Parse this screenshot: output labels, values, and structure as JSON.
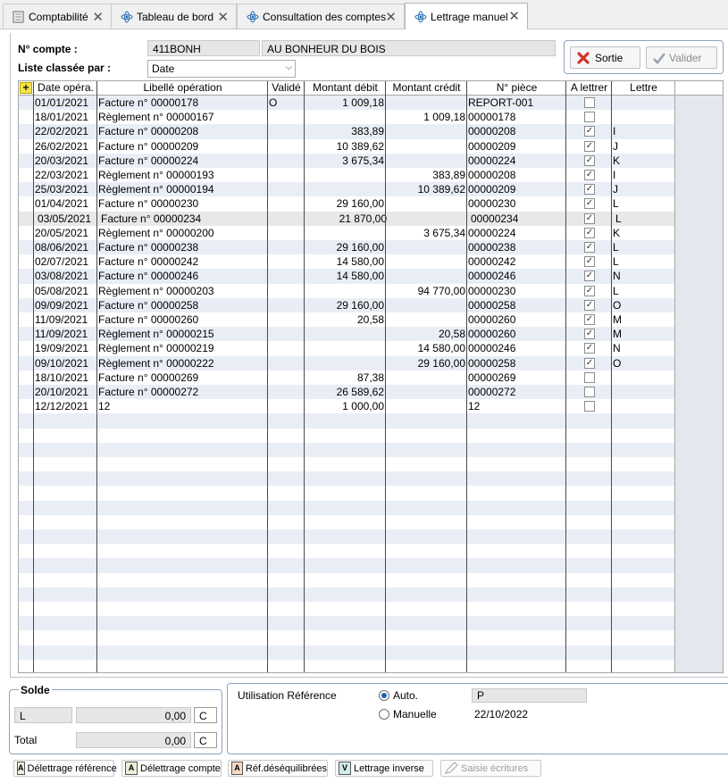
{
  "tabs": [
    {
      "label": "Comptabilité",
      "icon": "ledger-icon"
    },
    {
      "label": "Tableau de bord",
      "icon": "atom-icon"
    },
    {
      "label": "Consultation des comptes",
      "icon": "atom-icon"
    },
    {
      "label": "Lettrage manuel",
      "icon": "atom-icon",
      "active": true
    }
  ],
  "header": {
    "compte_label": "N° compte :",
    "compte_code": "411BONH",
    "compte_name": "AU BONHEUR DU BOIS",
    "tri_label": "Liste classée par :",
    "tri_value": "Date",
    "sortie_label": "Sortie",
    "valider_label": "Valider"
  },
  "grid": {
    "columns": [
      "Date opéra.",
      "Libellé opération",
      "Validé",
      "Montant débit",
      "Montant crédit",
      "N° pièce",
      "A lettrer",
      "Lettre"
    ],
    "rows": [
      {
        "date": "01/01/2021",
        "libelle": "Facture n° 00000178",
        "valide": "O",
        "debit": "1 009,18",
        "credit": "",
        "piece": "REPORT-001",
        "checked": false,
        "lettre": ""
      },
      {
        "date": "18/01/2021",
        "libelle": "Règlement n° 00000167",
        "valide": "",
        "debit": "",
        "credit": "1 009,18",
        "piece": "00000178",
        "checked": false,
        "lettre": ""
      },
      {
        "date": "22/02/2021",
        "libelle": "Facture n° 00000208",
        "valide": "",
        "debit": "383,89",
        "credit": "",
        "piece": "00000208",
        "checked": true,
        "lettre": "I"
      },
      {
        "date": "26/02/2021",
        "libelle": "Facture n° 00000209",
        "valide": "",
        "debit": "10 389,62",
        "credit": "",
        "piece": "00000209",
        "checked": true,
        "lettre": "J"
      },
      {
        "date": "20/03/2021",
        "libelle": "Facture n° 00000224",
        "valide": "",
        "debit": "3 675,34",
        "credit": "",
        "piece": "00000224",
        "checked": true,
        "lettre": "K"
      },
      {
        "date": "22/03/2021",
        "libelle": "Règlement n° 00000193",
        "valide": "",
        "debit": "",
        "credit": "383,89",
        "piece": "00000208",
        "checked": true,
        "lettre": "I"
      },
      {
        "date": "25/03/2021",
        "libelle": "Règlement n° 00000194",
        "valide": "",
        "debit": "",
        "credit": "10 389,62",
        "piece": "00000209",
        "checked": true,
        "lettre": "J"
      },
      {
        "date": "01/04/2021",
        "libelle": "Facture n° 00000230",
        "valide": "",
        "debit": "29 160,00",
        "credit": "",
        "piece": "00000230",
        "checked": true,
        "lettre": "L"
      },
      {
        "date": "03/05/2021",
        "libelle": "Facture n° 00000234",
        "valide": "",
        "debit": "21 870,00",
        "credit": "",
        "piece": "00000234",
        "checked": true,
        "lettre": "L",
        "current": true
      },
      {
        "date": "20/05/2021",
        "libelle": "Règlement n° 00000200",
        "valide": "",
        "debit": "",
        "credit": "3 675,34",
        "piece": "00000224",
        "checked": true,
        "lettre": "K"
      },
      {
        "date": "08/06/2021",
        "libelle": "Facture n° 00000238",
        "valide": "",
        "debit": "29 160,00",
        "credit": "",
        "piece": "00000238",
        "checked": true,
        "lettre": "L"
      },
      {
        "date": "02/07/2021",
        "libelle": "Facture n° 00000242",
        "valide": "",
        "debit": "14 580,00",
        "credit": "",
        "piece": "00000242",
        "checked": true,
        "lettre": "L"
      },
      {
        "date": "03/08/2021",
        "libelle": "Facture n° 00000246",
        "valide": "",
        "debit": "14 580,00",
        "credit": "",
        "piece": "00000246",
        "checked": true,
        "lettre": "N"
      },
      {
        "date": "05/08/2021",
        "libelle": "Règlement n° 00000203",
        "valide": "",
        "debit": "",
        "credit": "94 770,00",
        "piece": "00000230",
        "checked": true,
        "lettre": "L"
      },
      {
        "date": "09/09/2021",
        "libelle": "Facture n° 00000258",
        "valide": "",
        "debit": "29 160,00",
        "credit": "",
        "piece": "00000258",
        "checked": true,
        "lettre": "O"
      },
      {
        "date": "11/09/2021",
        "libelle": "Facture n° 00000260",
        "valide": "",
        "debit": "20,58",
        "credit": "",
        "piece": "00000260",
        "checked": true,
        "lettre": "M"
      },
      {
        "date": "11/09/2021",
        "libelle": "Règlement n° 00000215",
        "valide": "",
        "debit": "",
        "credit": "20,58",
        "piece": "00000260",
        "checked": true,
        "lettre": "M"
      },
      {
        "date": "19/09/2021",
        "libelle": "Règlement n° 00000219",
        "valide": "",
        "debit": "",
        "credit": "14 580,00",
        "piece": "00000246",
        "checked": true,
        "lettre": "N"
      },
      {
        "date": "09/10/2021",
        "libelle": "Règlement n° 00000222",
        "valide": "",
        "debit": "",
        "credit": "29 160,00",
        "piece": "00000258",
        "checked": true,
        "lettre": "O"
      },
      {
        "date": "18/10/2021",
        "libelle": "Facture n° 00000269",
        "valide": "",
        "debit": "87,38",
        "credit": "",
        "piece": "00000269",
        "checked": false,
        "lettre": ""
      },
      {
        "date": "20/10/2021",
        "libelle": "Facture n° 00000272",
        "valide": "",
        "debit": "26 589,62",
        "credit": "",
        "piece": "00000272",
        "checked": false,
        "lettre": ""
      },
      {
        "date": "12/12/2021",
        "libelle": "12",
        "valide": "",
        "debit": "1 000,00",
        "credit": "",
        "piece": "12",
        "checked": false,
        "lettre": ""
      }
    ]
  },
  "solde": {
    "title": "Solde",
    "line_label": "L",
    "line_value": "0,00",
    "line_sens": "C",
    "total_label": "Total",
    "total_value": "0,00",
    "total_sens": "C"
  },
  "reference": {
    "title": "Utilisation Référence",
    "auto_label": "Auto.",
    "auto_value": "P",
    "manuelle_label": "Manuelle",
    "manuelle_value": "22/10/2022",
    "selected": "auto"
  },
  "toolbar": [
    {
      "label": "Délettrage référence",
      "enabled": true
    },
    {
      "label": "Délettrage compte",
      "enabled": true
    },
    {
      "label": "Réf.déséquilibrées",
      "enabled": true
    },
    {
      "label": "Lettrage inverse",
      "enabled": true
    },
    {
      "label": "Saisie écritures",
      "enabled": false
    }
  ]
}
